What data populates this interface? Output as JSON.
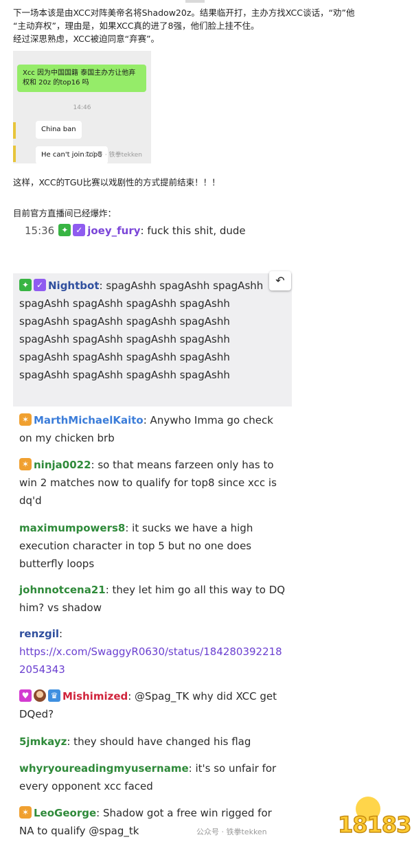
{
  "article": {
    "para1_line1": "下一场本该是由XCC对阵美帝名将Shadow20z。结果临开打，主办方找XCC谈话，“劝”他",
    "para1_line2": "“主动弃权”，理由是，如果XCC真的进了8强，他们脸上挂不住。",
    "para1_line3": "经过深思熟虑，XCC被迫同意“弃赛”。",
    "para2": "这样，XCC的TGU比赛以戏剧性的方式提前结束！！！",
    "para3": "目前官方直播间已经爆炸："
  },
  "wechat": {
    "green_bubble": "Xcc 因为中国国籍 泰国主办方让他弃权和 20z 的top16 吗",
    "time": "14:46",
    "msg1": "China ban",
    "msg2": "He can't join top8",
    "watermark": "公众号 · 铁拳tekken"
  },
  "chat": {
    "joey": {
      "time": "15:36",
      "user": "joey_fury",
      "text": ": fuck this shit, dude"
    },
    "nightbot": {
      "user": "Nightbot",
      "text": ": spagAshh spagAshh spagAshh spagAshh spagAshh spagAshh spagAshh spagAshh spagAshh spagAshh spagAshh spagAshh spagAshh spagAshh spagAshh spagAshh spagAshh spagAshh spagAshh spagAshh spagAshh spagAshh spagAshh"
    },
    "marth": {
      "user": "MarthMichaelKaito",
      "text": ": Anywho Imma go check on my chicken brb"
    },
    "ninja": {
      "user": "ninja0022",
      "text": ": so that means farzeen only has to win 2 matches now to qualify for top8 since xcc is dq'd"
    },
    "maximum": {
      "user": "maximumpowers8",
      "text": ": it sucks we have a high execution character in top 5 but no one does butterfly loops"
    },
    "john": {
      "user": "johnnotcena21",
      "text": ": they let him go all this way to DQ him? vs shadow"
    },
    "renzgil": {
      "user": "renzgil",
      "text": ":",
      "link": "https://x.com/SwaggyR0630/status/1842803922182054343"
    },
    "mishi": {
      "user": "Mishimized",
      "text": ": @Spag_TK why did XCC get DQed?"
    },
    "jmkayz": {
      "user": "5jmkayz",
      "text": ": they should have changed his flag"
    },
    "whyr": {
      "user": "whyryoureadingmyusername",
      "text": ": it's so unfair for every opponent xcc faced"
    },
    "leo": {
      "user": "LeoGeorge",
      "text": ": Shadow got a free win rigged for NA to qualify @spag_tk"
    }
  },
  "footer": {
    "watermark": "公众号 · 铁拳tekken",
    "logo": "18183"
  },
  "icons": [
    "sword-badge-icon",
    "verified-badge-icon",
    "reply-icon",
    "subscriber-badge-icon",
    "avatar-badge-icon",
    "crown-badge-icon"
  ],
  "colors": {
    "purple": "#7a45d8",
    "blue": "#3c7dd9",
    "green": "#2f8a3a",
    "red": "#d0243c",
    "navy": "#2f4f9e",
    "wechat_green": "#95ec69"
  }
}
